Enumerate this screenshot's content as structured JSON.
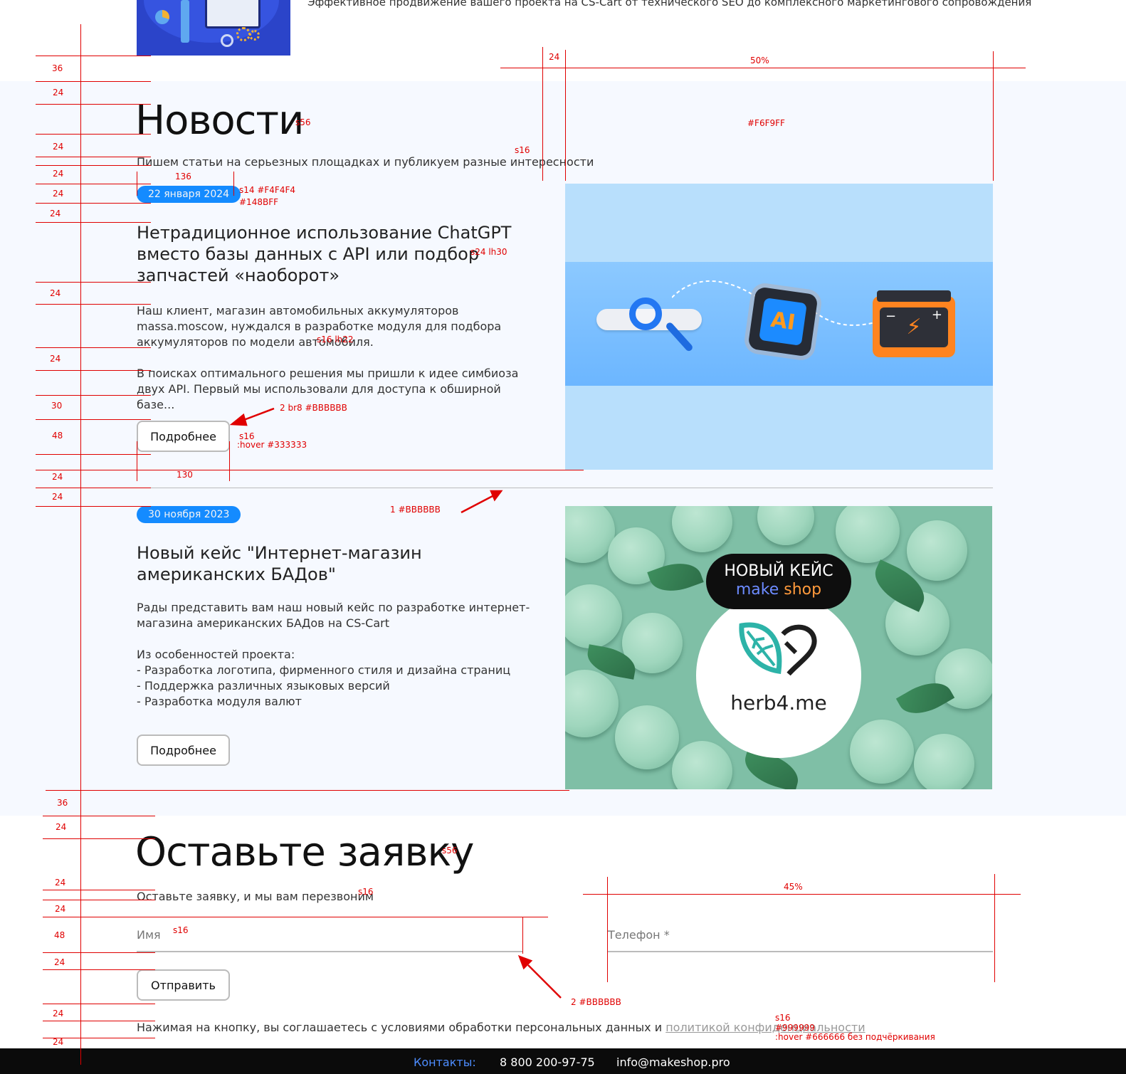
{
  "top": {
    "description": "Эффективное продвижение вашего проекта на CS-Cart от технического SEO до комплексного маркетингового сопровождения"
  },
  "news": {
    "title": "Новости",
    "subtitle": "Пишем статьи на серьезных площадках и публикуем разные интересности",
    "items": [
      {
        "date": "22 января 2024",
        "title": "Нетрадиционное использование ChatGPT вместо базы данных с API или подбор запчастей «наоборот»",
        "text": "Наш клиент, магазин автомобильных аккумуляторов massa.moscow, нуждался в разработке модуля для подбора аккумуляторов по модели автомобиля.\n\nВ поисках оптимального решения мы пришли к идее симбиоза двух API. Первый мы использовали для доступа к обширной базе...",
        "button": "Подробнее",
        "image": {
          "chip_label": "AI"
        }
      },
      {
        "date": "30 ноября 2023",
        "title": "Новый кейс \"Интернет-магазин американских БАДов\"",
        "text": "Рады представить вам наш новый кейс по разработке интернет-магазина американских БАДов на CS-Cart\n\nИз особенностей проекта:\n- Разработка логотипа, фирменного стиля и дизайна страниц\n- Поддержка различных языковых версий\n- Разработка модуля валют",
        "button": "Подробнее",
        "image": {
          "badge_line1": "НОВЫЙ КЕЙС",
          "badge_word1": "make",
          "badge_word2": "shop",
          "logo_text": "herb4.me"
        }
      }
    ]
  },
  "form": {
    "title": "Оставьте заявку",
    "subtitle": "Оставьте заявку, и мы вам перезвоним",
    "name_placeholder": "Имя",
    "phone_placeholder": "Телефон *",
    "submit": "Отправить",
    "policy_text": "Нажимая на кнопку, вы соглашаетесь с условиями обработки персональных данных и ",
    "policy_link": "политикой конфиденциальности"
  },
  "footer": {
    "contacts_label": "Контакты:",
    "phone": "8 800 200-97-75",
    "email": "info@makeshop.pro"
  },
  "annotations": {
    "s56": "s56",
    "bg": "#F6F9FF",
    "pct50": "50%",
    "s16": "s16",
    "w136": "136",
    "badge_style_1": "s14 #F4F4F4",
    "badge_style_2": "#148BFF",
    "title_style": "s24 lh30",
    "text_style": "s16 lh22",
    "btn_border": "2 br8 #BBBBBB",
    "btn_font": "s16",
    "btn_hover": ":hover #333333",
    "w130": "130",
    "divider_style": "1 #BBBBBB",
    "pct45": "45%",
    "field_border": "2 #BBBBBB",
    "link_color": "#999999",
    "link_hover": ":hover #666666 без подчёркивания",
    "spacing": [
      "36",
      "24",
      "24",
      "24",
      "24",
      "24",
      "24",
      "24",
      "30",
      "48",
      "24",
      "24",
      "36",
      "24",
      "24",
      "24",
      "48",
      "24",
      "24",
      "24"
    ],
    "w24": "24"
  },
  "colors": {
    "accent": "#148BFF",
    "section_bg": "#F6F9FF",
    "border": "#BBBBBB",
    "link": "#999999",
    "annotation": "#E00000",
    "footer_bg": "#0B0B0B",
    "footer_contacts": "#4D8DFF"
  }
}
